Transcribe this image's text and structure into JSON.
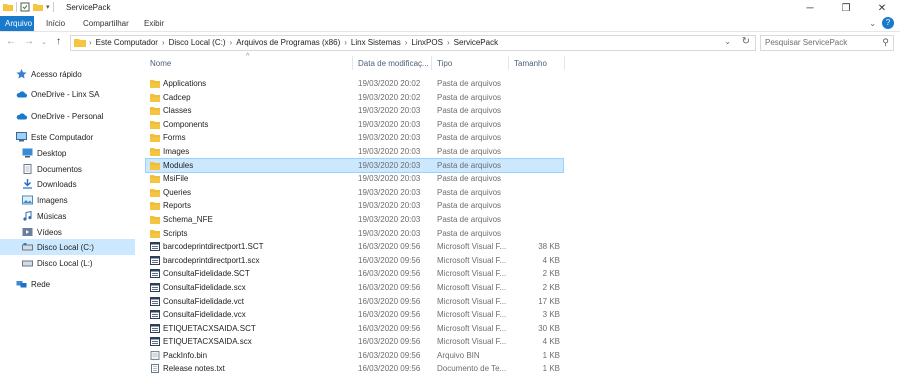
{
  "window": {
    "title": "ServicePack"
  },
  "ribbon": {
    "tabs": [
      "Arquivo",
      "Início",
      "Compartilhar",
      "Exibir"
    ]
  },
  "address": {
    "crumbs": [
      "Este Computador",
      "Disco Local (C:)",
      "Arquivos de Programas (x86)",
      "Linx Sistemas",
      "LinxPOS",
      "ServicePack"
    ],
    "search_placeholder": "Pesquisar ServicePack"
  },
  "sidebar": {
    "items": [
      {
        "label": "Acesso rápido",
        "icon": "star-icon"
      },
      {
        "label": "OneDrive - Linx SA",
        "icon": "cloud-icon"
      },
      {
        "label": "OneDrive - Personal",
        "icon": "cloud-icon"
      },
      {
        "label": "Este Computador",
        "icon": "computer-icon"
      },
      {
        "label": "Desktop",
        "icon": "desktop-icon"
      },
      {
        "label": "Documentos",
        "icon": "document-icon"
      },
      {
        "label": "Downloads",
        "icon": "download-icon"
      },
      {
        "label": "Imagens",
        "icon": "image-icon"
      },
      {
        "label": "Músicas",
        "icon": "music-icon"
      },
      {
        "label": "Vídeos",
        "icon": "video-icon"
      },
      {
        "label": "Disco Local (C:)",
        "icon": "drive-icon",
        "selected": true
      },
      {
        "label": "Disco Local (L:)",
        "icon": "drive-icon"
      },
      {
        "label": "Rede",
        "icon": "network-icon"
      }
    ]
  },
  "columns": {
    "name": "Nome",
    "date": "Data de modificaç...",
    "type": "Tipo",
    "size": "Tamanho"
  },
  "files": [
    {
      "name": "Applications",
      "date": "19/03/2020 20:02",
      "type": "Pasta de arquivos",
      "size": "",
      "kind": "folder"
    },
    {
      "name": "Cadcep",
      "date": "19/03/2020 20:02",
      "type": "Pasta de arquivos",
      "size": "",
      "kind": "folder"
    },
    {
      "name": "Classes",
      "date": "19/03/2020 20:03",
      "type": "Pasta de arquivos",
      "size": "",
      "kind": "folder"
    },
    {
      "name": "Components",
      "date": "19/03/2020 20:03",
      "type": "Pasta de arquivos",
      "size": "",
      "kind": "folder"
    },
    {
      "name": "Forms",
      "date": "19/03/2020 20:03",
      "type": "Pasta de arquivos",
      "size": "",
      "kind": "folder"
    },
    {
      "name": "Images",
      "date": "19/03/2020 20:03",
      "type": "Pasta de arquivos",
      "size": "",
      "kind": "folder"
    },
    {
      "name": "Modules",
      "date": "19/03/2020 20:03",
      "type": "Pasta de arquivos",
      "size": "",
      "kind": "folder",
      "selected": true
    },
    {
      "name": "MsiFile",
      "date": "19/03/2020 20:03",
      "type": "Pasta de arquivos",
      "size": "",
      "kind": "folder"
    },
    {
      "name": "Queries",
      "date": "19/03/2020 20:03",
      "type": "Pasta de arquivos",
      "size": "",
      "kind": "folder"
    },
    {
      "name": "Reports",
      "date": "19/03/2020 20:03",
      "type": "Pasta de arquivos",
      "size": "",
      "kind": "folder"
    },
    {
      "name": "Schema_NFE",
      "date": "19/03/2020 20:03",
      "type": "Pasta de arquivos",
      "size": "",
      "kind": "folder"
    },
    {
      "name": "Scripts",
      "date": "19/03/2020 20:03",
      "type": "Pasta de arquivos",
      "size": "",
      "kind": "folder"
    },
    {
      "name": "barcodeprintdirectport1.SCT",
      "date": "16/03/2020 09:56",
      "type": "Microsoft Visual F...",
      "size": "38 KB",
      "kind": "vfp"
    },
    {
      "name": "barcodeprintdirectport1.scx",
      "date": "16/03/2020 09:56",
      "type": "Microsoft Visual F...",
      "size": "4 KB",
      "kind": "vfp"
    },
    {
      "name": "ConsultaFidelidade.SCT",
      "date": "16/03/2020 09:56",
      "type": "Microsoft Visual F...",
      "size": "2 KB",
      "kind": "vfp"
    },
    {
      "name": "ConsultaFidelidade.scx",
      "date": "16/03/2020 09:56",
      "type": "Microsoft Visual F...",
      "size": "2 KB",
      "kind": "vfp"
    },
    {
      "name": "ConsultaFidelidade.vct",
      "date": "16/03/2020 09:56",
      "type": "Microsoft Visual F...",
      "size": "17 KB",
      "kind": "vfp"
    },
    {
      "name": "ConsultaFidelidade.vcx",
      "date": "16/03/2020 09:56",
      "type": "Microsoft Visual F...",
      "size": "3 KB",
      "kind": "vfp"
    },
    {
      "name": "ETIQUETACXSAIDA.SCT",
      "date": "16/03/2020 09:56",
      "type": "Microsoft Visual F...",
      "size": "30 KB",
      "kind": "vfp"
    },
    {
      "name": "ETIQUETACXSAIDA.scx",
      "date": "16/03/2020 09:56",
      "type": "Microsoft Visual F...",
      "size": "4 KB",
      "kind": "vfp"
    },
    {
      "name": "PackInfo.bin",
      "date": "16/03/2020 09:56",
      "type": "Arquivo BIN",
      "size": "1 KB",
      "kind": "bin"
    },
    {
      "name": "Release notes.txt",
      "date": "16/03/2020 09:56",
      "type": "Documento de Te...",
      "size": "1 KB",
      "kind": "txt"
    }
  ],
  "colors": {
    "accent": "#1979ca",
    "selection": "#cce8ff",
    "folder": "#f5c542"
  }
}
